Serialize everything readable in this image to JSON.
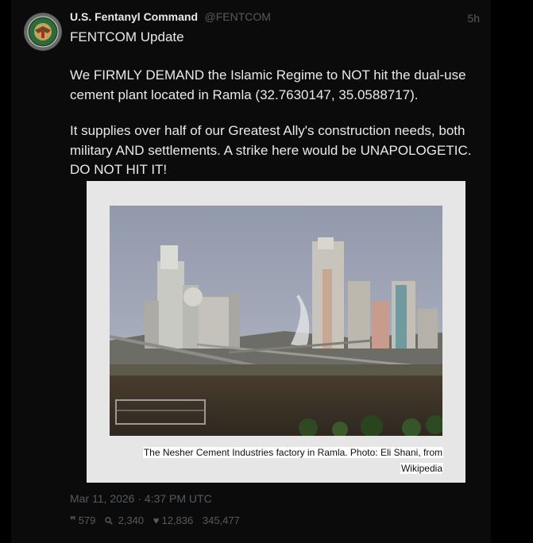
{
  "account": {
    "name": "U.S. Fentanyl Command",
    "handle": "@FENTCOM",
    "relative_time": "5h",
    "avatar_icon": "fentcom-seal-logo"
  },
  "post": {
    "title": "FENTCOM Update",
    "paragraphs": [
      "We FIRMLY DEMAND the Islamic Regime to NOT hit the dual-use cement plant located in Ramla (32.7630147, 35.0588717).",
      "It supplies over half of our Greatest Ally's construction needs, both military AND settlements. A strike here would be UNAPOLOGETIC. DO NOT HIT IT!"
    ]
  },
  "media": {
    "photo_icon": "cement-factory-photo",
    "caption_line1": "The Nesher Cement Industries factory in Ramla. Photo: Eli Shani, from",
    "caption_line2": "Wikipedia"
  },
  "footer": {
    "date": "Mar 11, 2026 · 4:37 PM UTC",
    "replies_icon": "quote-icon",
    "replies": "579",
    "search_icon": "search-icon",
    "searches": "2,340",
    "likes_icon": "heart-icon",
    "likes": "12,836",
    "views": "345,477"
  },
  "colors": {
    "background": "#000000",
    "card": "#0b0b0b",
    "text": "#e7e9ea",
    "muted": "#565a5e"
  }
}
